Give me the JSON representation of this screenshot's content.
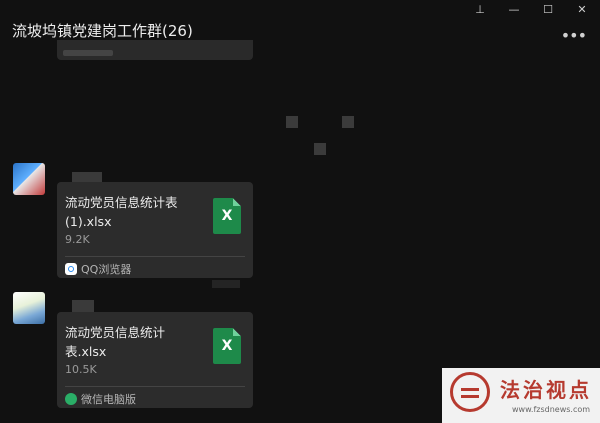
{
  "window": {
    "pin_glyph": "⊥",
    "minimize_glyph": "—",
    "maximize_glyph": "☐",
    "close_glyph": "✕"
  },
  "chat": {
    "title": "流坡坞镇党建岗工作群(26)",
    "more_glyph": "•••"
  },
  "messages": [
    {
      "file_name": "流动党员信息统计表(1).xlsx",
      "file_size": "9.2K",
      "file_icon": "excel-icon",
      "icon_letter": "X",
      "source": "QQ浏览器",
      "source_icon": "qq-browser-icon"
    },
    {
      "file_name": "流动党员信息统计表.xlsx",
      "file_size": "10.5K",
      "file_icon": "excel-icon",
      "icon_letter": "X",
      "source": "微信电脑版",
      "source_icon": "wechat-icon"
    }
  ],
  "watermark": {
    "title": "法治视点",
    "url": "www.fzsdnews.com"
  },
  "colors": {
    "background": "#111111",
    "card": "#2c2c2c",
    "excel_green": "#1e8a4a",
    "watermark_red": "#b63a2f"
  }
}
